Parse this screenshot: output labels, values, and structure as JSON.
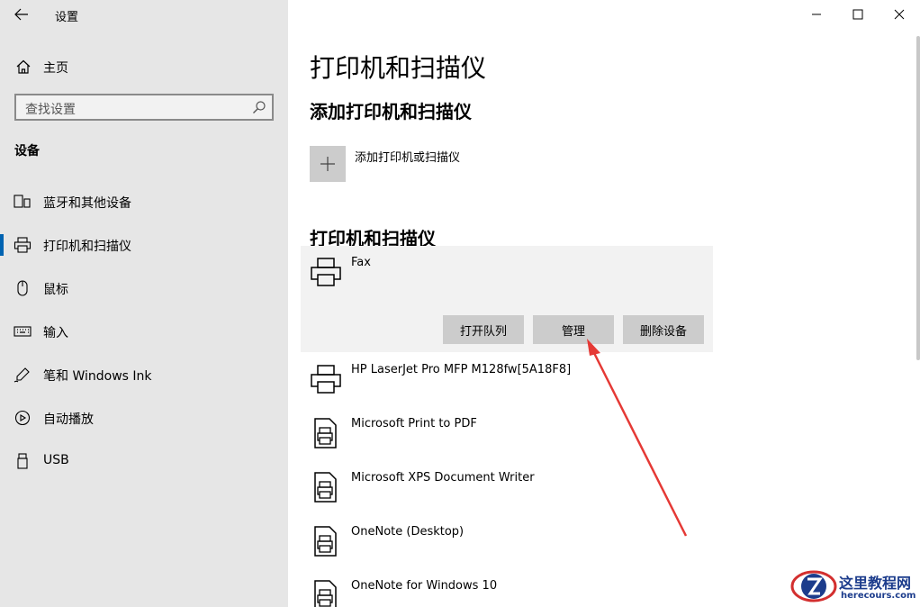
{
  "app": {
    "title": "设置"
  },
  "sidebar": {
    "home_label": "主页",
    "search_placeholder": "查找设置",
    "section_title": "设备",
    "items": [
      {
        "label": "蓝牙和其他设备",
        "icon": "bluetooth-devices-icon"
      },
      {
        "label": "打印机和扫描仪",
        "icon": "printer-icon",
        "active": true
      },
      {
        "label": "鼠标",
        "icon": "mouse-icon"
      },
      {
        "label": "输入",
        "icon": "keyboard-icon"
      },
      {
        "label": "笔和 Windows Ink",
        "icon": "pen-icon"
      },
      {
        "label": "自动播放",
        "icon": "autoplay-icon"
      },
      {
        "label": "USB",
        "icon": "usb-icon"
      }
    ]
  },
  "main": {
    "page_title": "打印机和扫描仪",
    "add_section_title": "添加打印机和扫描仪",
    "add_label": "添加打印机或扫描仪",
    "list_section_title": "打印机和扫描仪",
    "devices": [
      {
        "name": "Fax",
        "icon": "printer-icon"
      },
      {
        "name": "HP LaserJet Pro MFP M128fw[5A18F8]",
        "icon": "printer-icon"
      },
      {
        "name": "Microsoft Print to PDF",
        "icon": "document-printer-icon"
      },
      {
        "name": "Microsoft XPS Document Writer",
        "icon": "document-printer-icon"
      },
      {
        "name": "OneNote (Desktop)",
        "icon": "document-printer-icon"
      },
      {
        "name": "OneNote for Windows 10",
        "icon": "document-printer-icon"
      }
    ],
    "actions": {
      "open_queue": "打开队列",
      "manage": "管理",
      "remove": "删除设备"
    }
  },
  "watermark": {
    "cn": "这里教程网",
    "en": "herecours.com"
  },
  "colors": {
    "sidebar_bg": "#e6e6e6",
    "accent": "#0063b1",
    "button_bg": "#cccccc",
    "arrow": "#e53935"
  }
}
